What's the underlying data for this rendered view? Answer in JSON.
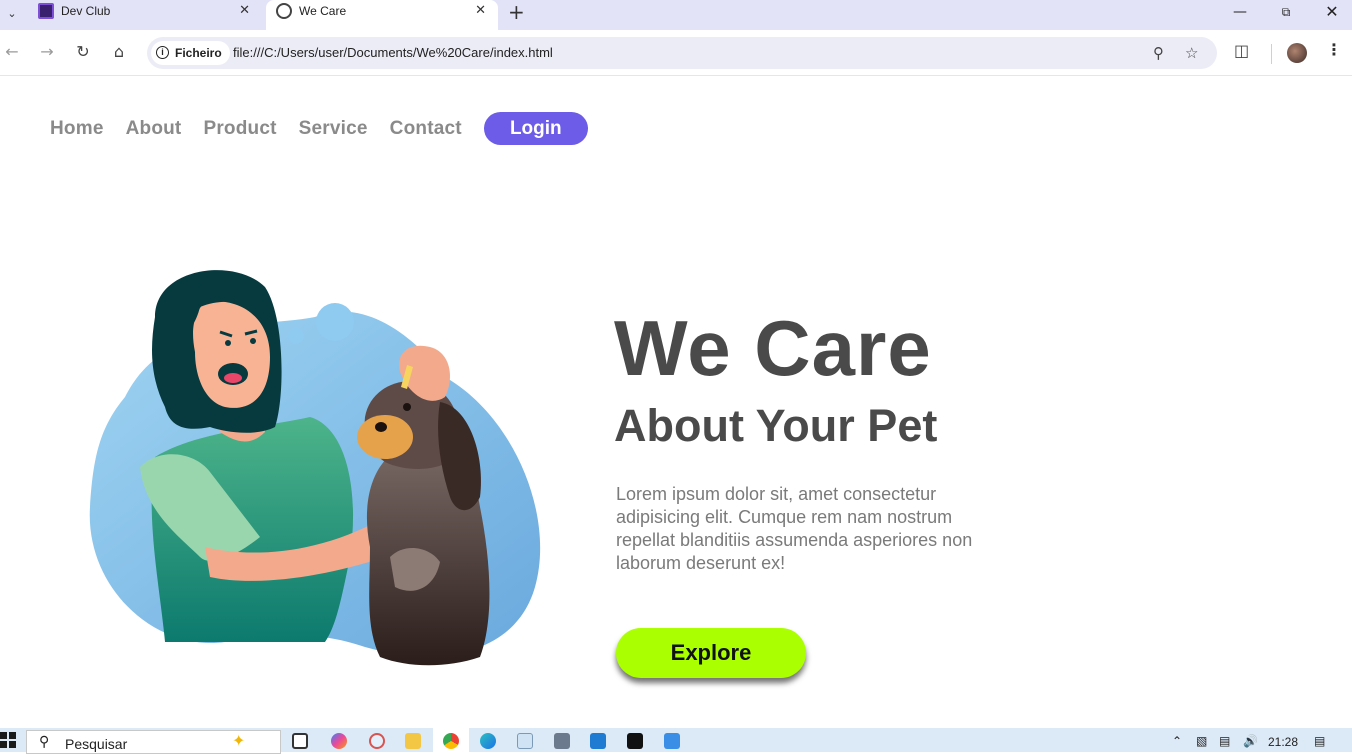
{
  "browser": {
    "tabs": [
      {
        "title": "Dev Club",
        "active": false
      },
      {
        "title": "We Care",
        "active": true
      }
    ],
    "address": {
      "chip_label": "Ficheiro",
      "url": "file:///C:/Users/user/Documents/We%20Care/index.html"
    }
  },
  "nav": {
    "items": [
      "Home",
      "About",
      "Product",
      "Service",
      "Contact"
    ],
    "login_label": "Login"
  },
  "hero": {
    "title": "We Care",
    "subtitle": "About Your Pet",
    "text": "Lorem ipsum dolor sit, amet consectetur adipisicing elit. Cumque rem nam nostrum repellat blanditiis assumenda asperiores non laborum deserunt ex!",
    "button_label": "Explore"
  },
  "taskbar": {
    "search_placeholder": "Pesquisar",
    "clock": "21:28"
  },
  "colors": {
    "accent": "#6c5ce7",
    "explore": "#aaff00",
    "heading": "#4a4a4a",
    "nav_text": "#8a8a8a"
  }
}
